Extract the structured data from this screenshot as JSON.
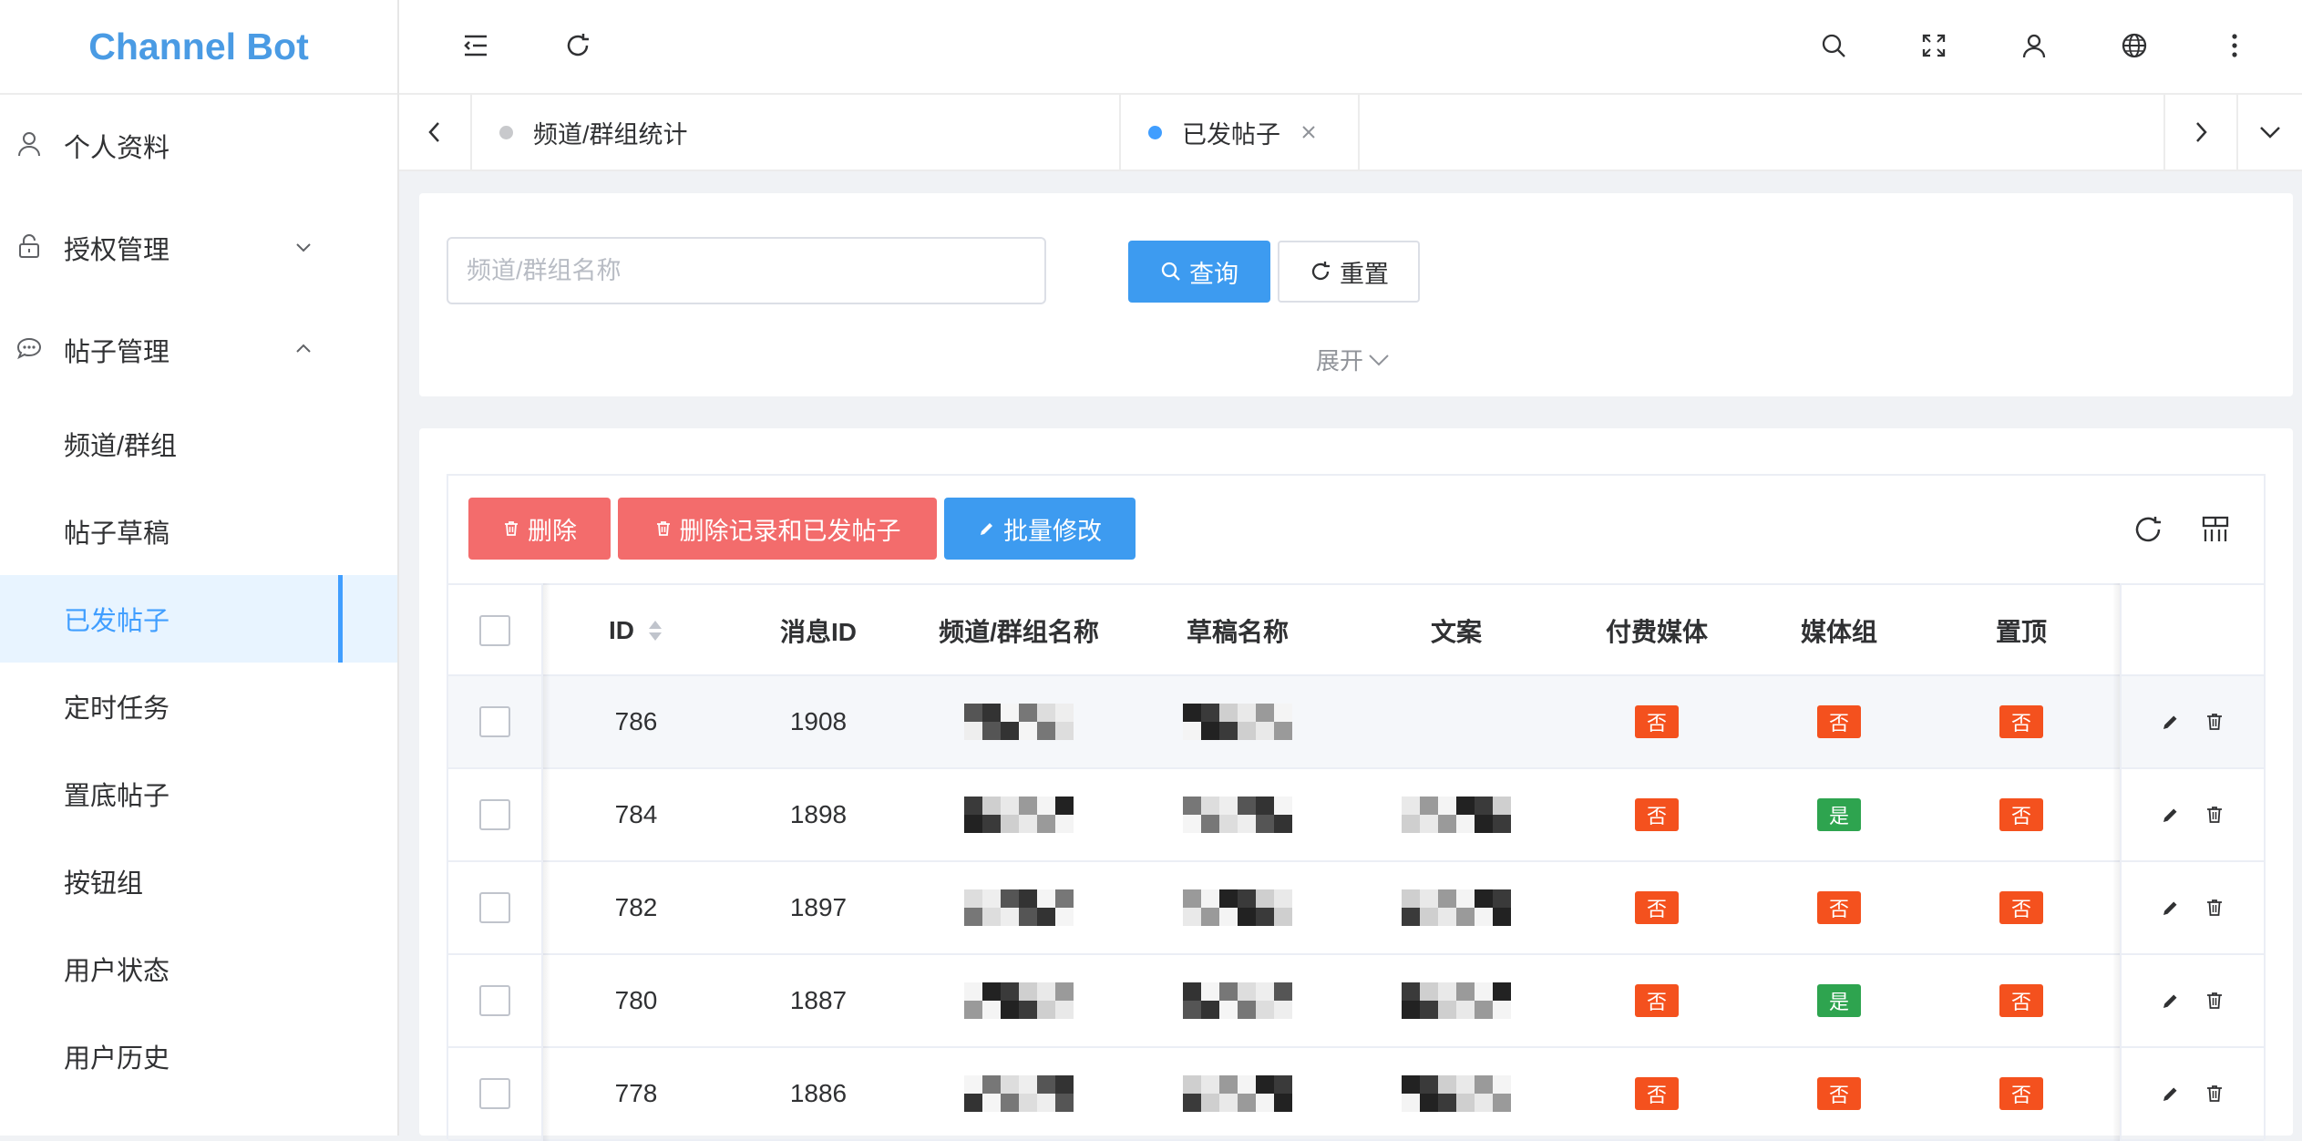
{
  "app": {
    "brand": "Channel Bot"
  },
  "sidebar": {
    "items": [
      {
        "key": "profile",
        "label": "个人资料",
        "icon": "user-icon"
      },
      {
        "key": "auth",
        "label": "授权管理",
        "icon": "lock-icon",
        "arrow": "down"
      },
      {
        "key": "posts",
        "label": "帖子管理",
        "icon": "chat-icon",
        "arrow": "up"
      }
    ],
    "subitems": [
      {
        "key": "channels",
        "label": "频道/群组"
      },
      {
        "key": "drafts",
        "label": "帖子草稿"
      },
      {
        "key": "sent",
        "label": "已发帖子",
        "active": true
      },
      {
        "key": "tasks",
        "label": "定时任务"
      },
      {
        "key": "bottom",
        "label": "置底帖子"
      },
      {
        "key": "buttons",
        "label": "按钮组"
      },
      {
        "key": "user-status",
        "label": "用户状态"
      },
      {
        "key": "user-history",
        "label": "用户历史"
      }
    ]
  },
  "header": {
    "icons": [
      "menu-fold-icon",
      "refresh-icon",
      "search-icon",
      "fullscreen-icon",
      "user-icon",
      "globe-icon",
      "more-icon"
    ]
  },
  "tags": [
    {
      "label": "频道/群组统计",
      "active": false
    },
    {
      "label": "已发帖子",
      "active": true
    }
  ],
  "search": {
    "placeholder": "频道/群组名称",
    "query_label": "查询",
    "reset_label": "重置",
    "expand_label": "展开"
  },
  "toolbar": {
    "delete_label": "删除",
    "delete_records_label": "删除记录和已发帖子",
    "batch_edit_label": "批量修改"
  },
  "table": {
    "columns": [
      "ID",
      "消息ID",
      "频道/群组名称",
      "草稿名称",
      "文案",
      "付费媒体",
      "媒体组",
      "置顶"
    ],
    "rows": [
      {
        "id": "786",
        "msg_id": "1908",
        "paid": "否",
        "group": "否",
        "pin": "否"
      },
      {
        "id": "784",
        "msg_id": "1898",
        "paid": "否",
        "group": "是",
        "pin": "否"
      },
      {
        "id": "782",
        "msg_id": "1897",
        "paid": "否",
        "group": "否",
        "pin": "否"
      },
      {
        "id": "780",
        "msg_id": "1887",
        "paid": "否",
        "group": "是",
        "pin": "否"
      },
      {
        "id": "778",
        "msg_id": "1886",
        "paid": "否",
        "group": "否",
        "pin": "否"
      }
    ]
  },
  "colors": {
    "accent": "#409eff",
    "danger_btn": "#f36c6c",
    "no_badge": "#f4511e",
    "yes_badge": "#2ea44f",
    "brand": "#4a9be4"
  }
}
